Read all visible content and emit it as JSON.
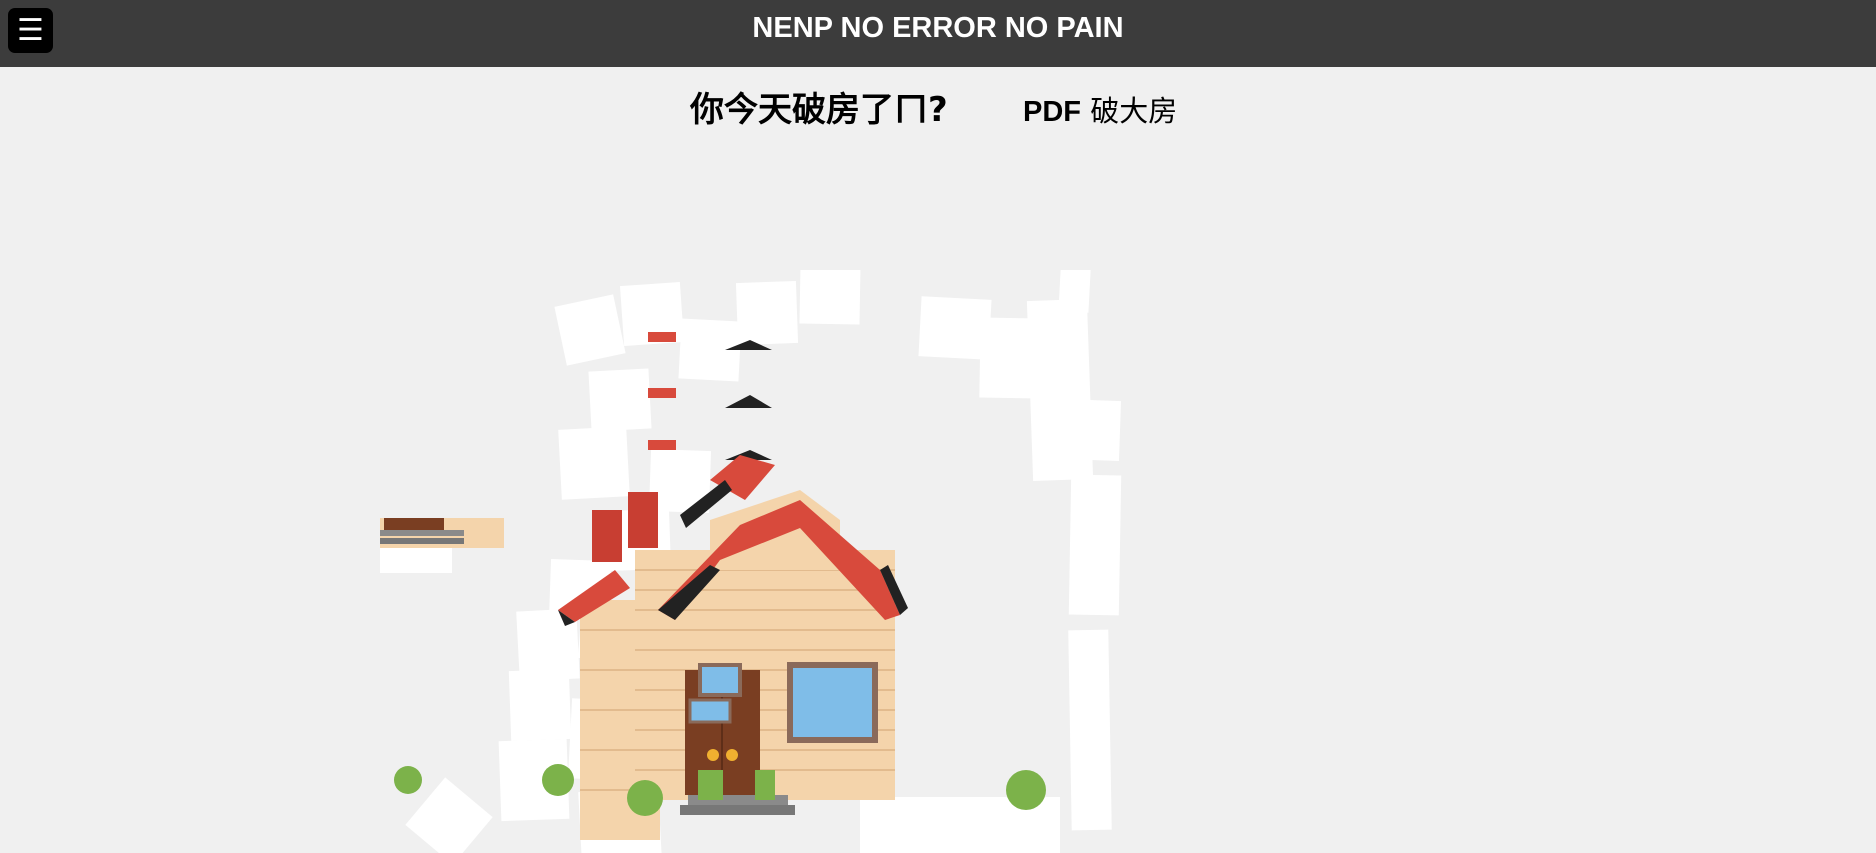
{
  "header": {
    "menu_icon": "hamburger-menu-icon",
    "menu_glyph": "☰",
    "title": "NENP NO ERROR NO PAIN",
    "background": "#3c3c3c"
  },
  "main": {
    "question": "你今天破房了ㄇ?",
    "pdf_link_prefix": "PDF",
    "pdf_link_text": "破大房"
  },
  "scene": {
    "description_icon": "broken-house-puzzle-image",
    "colors": {
      "wall": "#f4d4ab",
      "wall_line": "#e2bb8e",
      "roof": "#d84a3c",
      "roof_dark": "#222222",
      "door": "#7a3e22",
      "window": "#7fbde8",
      "window_frame": "#8a6a5a",
      "bush": "#7cb24a",
      "step": "#8a8a8a",
      "knob": "#f0b030"
    }
  }
}
